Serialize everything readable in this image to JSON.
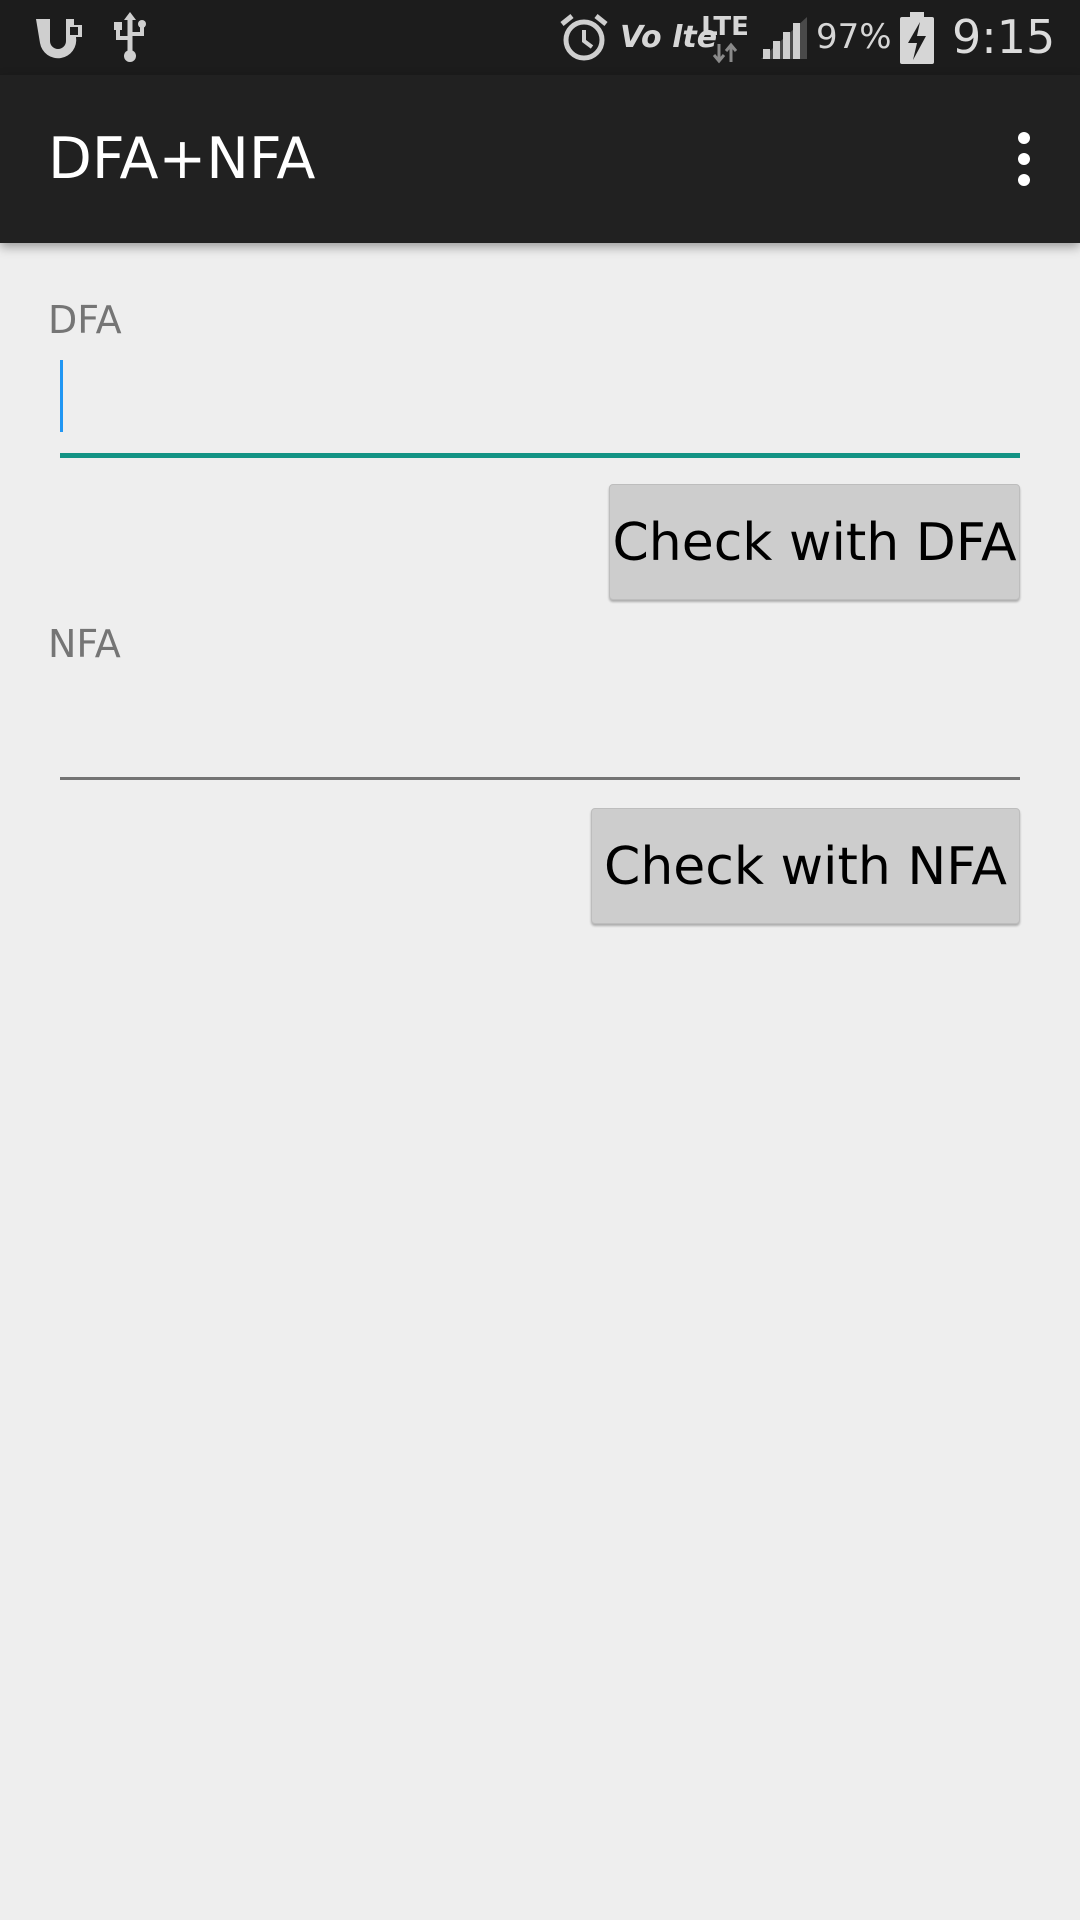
{
  "status_bar": {
    "battery_percent": "97%",
    "time": "9:15",
    "network_label": "LTE",
    "volte_label": "Vo lte",
    "icons": [
      "uc-browser-icon",
      "usb-icon",
      "alarm-icon",
      "volte-icon",
      "lte-data-icon",
      "signal-icon",
      "battery-charging-icon"
    ]
  },
  "app_bar": {
    "title": "DFA+NFA",
    "menu_icon": "overflow-menu-icon"
  },
  "dfa_section": {
    "label": "DFA",
    "input_value": "",
    "button_label": "Check with DFA"
  },
  "nfa_section": {
    "label": "NFA",
    "input_value": "",
    "button_label": "Check with NFA"
  },
  "colors": {
    "accent": "#139384",
    "cursor": "#2196f3",
    "app_bar": "#212121",
    "status_bar": "#1c1c1c",
    "background": "#eeeeee",
    "button": "#cdcdcd"
  }
}
